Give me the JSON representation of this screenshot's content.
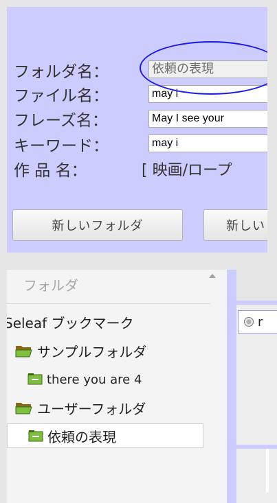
{
  "form": {
    "folder": {
      "label": "フォルダ名：",
      "value": "依頼の表現"
    },
    "file": {
      "label": "ファイル名：",
      "value": "may i"
    },
    "phrase": {
      "label": "フレーズ名：",
      "value": "May I see your"
    },
    "keyword": {
      "label": "キーワード：",
      "value": "may i"
    },
    "work": {
      "label": "作 品 名：",
      "value": "[ 映画/ロープ"
    }
  },
  "buttons": {
    "new_folder": "新しいフォルダ",
    "new_other": "新しい"
  },
  "sidebar": {
    "header": "フォルダ",
    "items": [
      {
        "label": "Seleaf ブックマーク",
        "icon": "arrow-icon"
      },
      {
        "label": "サンプルフォルダ",
        "icon": "folder-open-icon"
      },
      {
        "label": "there you are 4",
        "icon": "folder-icon"
      },
      {
        "label": "ユーザーフォルダ",
        "icon": "folder-open-icon"
      },
      {
        "label": "依頼の表現",
        "icon": "folder-icon"
      }
    ]
  },
  "right_pane": {
    "item_label": "r"
  },
  "colors": {
    "panel": "#ccccff",
    "annotation_oval": "#1a1ae8",
    "folder_icon": "#7fbf3f"
  }
}
